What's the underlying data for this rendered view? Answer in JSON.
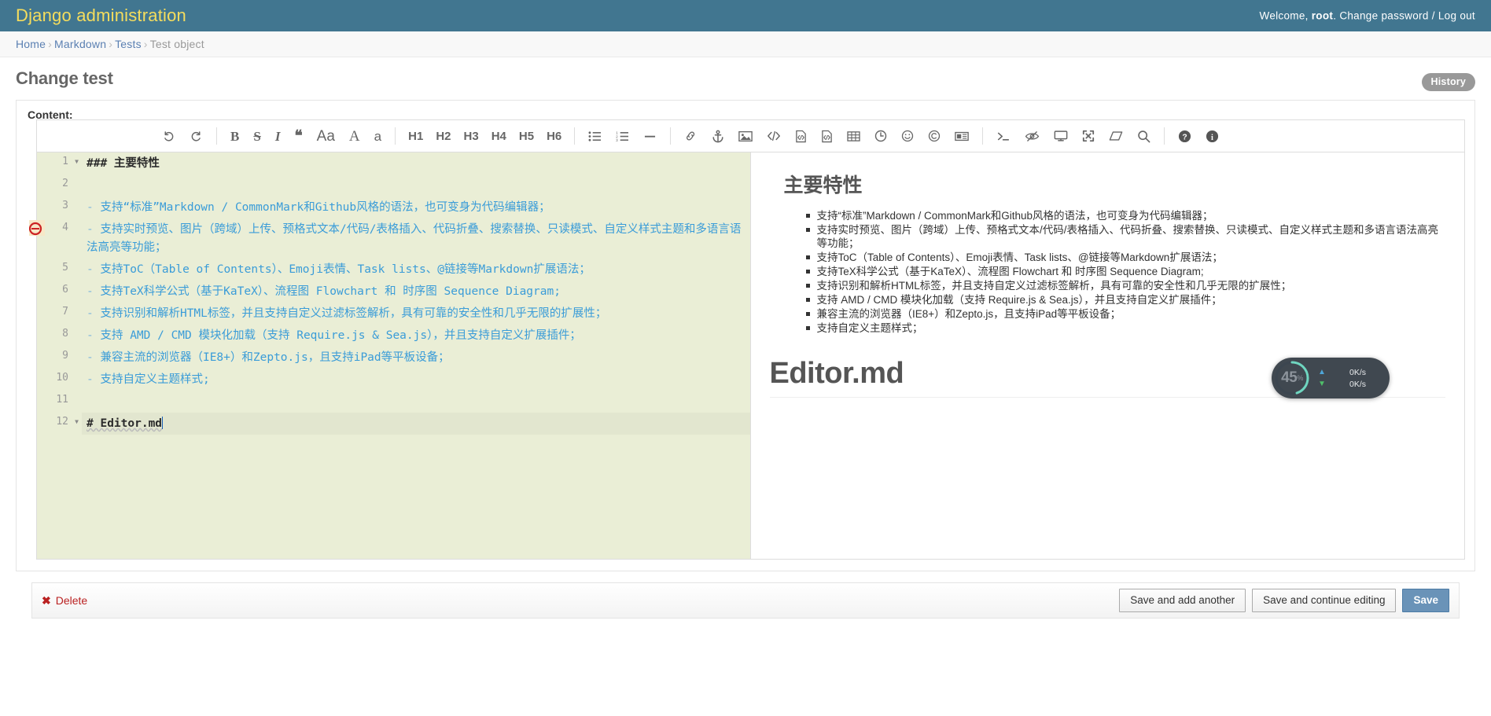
{
  "header": {
    "site_title": "Django administration",
    "welcome_prefix": "Welcome,",
    "username": "root",
    "welcome_dot": ".",
    "change_password": "Change password",
    "separator": "/",
    "log_out": "Log out"
  },
  "breadcrumbs": [
    {
      "label": "Home",
      "link": true
    },
    {
      "label": "Markdown",
      "link": true
    },
    {
      "label": "Tests",
      "link": true
    },
    {
      "label": "Test object",
      "link": false
    }
  ],
  "content": {
    "page_title": "Change test",
    "history_button": "History",
    "field_label": "Content:"
  },
  "toolbar": {
    "groups": [
      [
        {
          "name": "undo-icon",
          "glyph": "↶"
        },
        {
          "name": "redo-icon",
          "glyph": "↷"
        }
      ],
      [
        {
          "name": "bold-icon",
          "glyph": "B"
        },
        {
          "name": "strikethrough-icon",
          "glyph": "S"
        },
        {
          "name": "italic-icon",
          "glyph": "I"
        },
        {
          "name": "quote-icon",
          "glyph": "❝"
        },
        {
          "name": "uppercase-icon",
          "glyph": "Aa"
        },
        {
          "name": "font-size-large-icon",
          "glyph": "A"
        },
        {
          "name": "font-size-small-icon",
          "glyph": "a"
        }
      ],
      [
        {
          "name": "heading-h1-icon",
          "glyph": "H1"
        },
        {
          "name": "heading-h2-icon",
          "glyph": "H2"
        },
        {
          "name": "heading-h3-icon",
          "glyph": "H3"
        },
        {
          "name": "heading-h4-icon",
          "glyph": "H4"
        },
        {
          "name": "heading-h5-icon",
          "glyph": "H5"
        },
        {
          "name": "heading-h6-icon",
          "glyph": "H6"
        }
      ],
      [
        {
          "name": "unordered-list-icon",
          "glyph": "list-ul"
        },
        {
          "name": "ordered-list-icon",
          "glyph": "list-ol"
        },
        {
          "name": "horizontal-rule-icon",
          "glyph": "—"
        }
      ],
      [
        {
          "name": "link-icon",
          "glyph": "link"
        },
        {
          "name": "anchor-icon",
          "glyph": "anchor"
        },
        {
          "name": "image-icon",
          "glyph": "image"
        },
        {
          "name": "code-inline-icon",
          "glyph": "</>"
        },
        {
          "name": "code-block-icon",
          "glyph": "file-code"
        },
        {
          "name": "preformatted-text-icon",
          "glyph": "file-code-2"
        },
        {
          "name": "table-icon",
          "glyph": "table"
        },
        {
          "name": "datetime-icon",
          "glyph": "clock"
        },
        {
          "name": "emoji-icon",
          "glyph": "smile"
        },
        {
          "name": "html-entities-icon",
          "glyph": "copyright"
        },
        {
          "name": "page-break-icon",
          "glyph": "newspaper"
        }
      ],
      [
        {
          "name": "toggle-editor-icon",
          "glyph": "terminal"
        },
        {
          "name": "toggle-preview-icon",
          "glyph": "eye-slash"
        },
        {
          "name": "watch-preview-icon",
          "glyph": "desktop"
        },
        {
          "name": "fullscreen-icon",
          "glyph": "expand"
        },
        {
          "name": "clear-icon",
          "glyph": "eraser"
        },
        {
          "name": "search-icon",
          "glyph": "search"
        }
      ],
      [
        {
          "name": "help-icon",
          "glyph": "question-circle"
        },
        {
          "name": "info-icon",
          "glyph": "info-circle"
        }
      ]
    ]
  },
  "editor": {
    "lines": [
      {
        "num": "1",
        "fold": true,
        "heading": true,
        "text": "### 主要特性"
      },
      {
        "num": "2",
        "fold": false,
        "heading": false,
        "text": ""
      },
      {
        "num": "3",
        "fold": false,
        "heading": false,
        "text": "- 支持“标准”Markdown / CommonMark和Github风格的语法，也可变身为代码编辑器；"
      },
      {
        "num": "4",
        "fold": false,
        "heading": false,
        "text": "- 支持实时预览、图片（跨域）上传、预格式文本/代码/表格插入、代码折叠、搜索替换、只读模式、自定义样式主题和多语言语法高亮等功能；"
      },
      {
        "num": "5",
        "fold": false,
        "heading": false,
        "text": "- 支持ToC（Table of Contents）、Emoji表情、Task lists、@链接等Markdown扩展语法；"
      },
      {
        "num": "6",
        "fold": false,
        "heading": false,
        "text": "- 支持TeX科学公式（基于KaTeX）、流程图 Flowchart 和 时序图 Sequence Diagram;"
      },
      {
        "num": "7",
        "fold": false,
        "heading": false,
        "text": "- 支持识别和解析HTML标签，并且支持自定义过滤标签解析，具有可靠的安全性和几乎无限的扩展性；"
      },
      {
        "num": "8",
        "fold": false,
        "heading": false,
        "text": "- 支持 AMD / CMD 模块化加载（支持 Require.js & Sea.js），并且支持自定义扩展插件；"
      },
      {
        "num": "9",
        "fold": false,
        "heading": false,
        "text": "- 兼容主流的浏览器（IE8+）和Zepto.js，且支持iPad等平板设备；"
      },
      {
        "num": "10",
        "fold": false,
        "heading": false,
        "text": "- 支持自定义主题样式;"
      },
      {
        "num": "11",
        "fold": false,
        "heading": false,
        "text": ""
      },
      {
        "num": "12",
        "fold": true,
        "heading": true,
        "text": "# Editor.md",
        "active": true,
        "caret": true
      }
    ]
  },
  "preview": {
    "heading": "主要特性",
    "items": [
      "支持“标准”Markdown / CommonMark和Github风格的语法，也可变身为代码编辑器；",
      "支持实时预览、图片（跨域）上传、预格式文本/代码/表格插入、代码折叠、搜索替换、只读模式、自定义样式主题和多语言语法高亮等功能；",
      "支持ToC（Table of Contents）、Emoji表情、Task lists、@链接等Markdown扩展语法；",
      "支持TeX科学公式（基于KaTeX）、流程图 Flowchart 和 时序图 Sequence Diagram;",
      "支持识别和解析HTML标签，并且支持自定义过滤标签解析，具有可靠的安全性和几乎无限的扩展性；",
      "支持 AMD / CMD 模块化加载（支持 Require.js & Sea.js），并且支持自定义扩展插件；",
      "兼容主流的浏览器（IE8+）和Zepto.js，且支持iPad等平板设备；",
      "支持自定义主题样式；"
    ],
    "title": "Editor.md"
  },
  "float_widget": {
    "percent": "45",
    "percent_symbol": "%",
    "upload_rate": "0K/s",
    "download_rate": "0K/s",
    "ring_color": "#6fd6c0",
    "panel_color": "#303841"
  },
  "submit_row": {
    "delete_label": "Delete",
    "save_and_add_another": "Save and add another",
    "save_and_continue": "Save and continue editing",
    "save": "Save"
  }
}
